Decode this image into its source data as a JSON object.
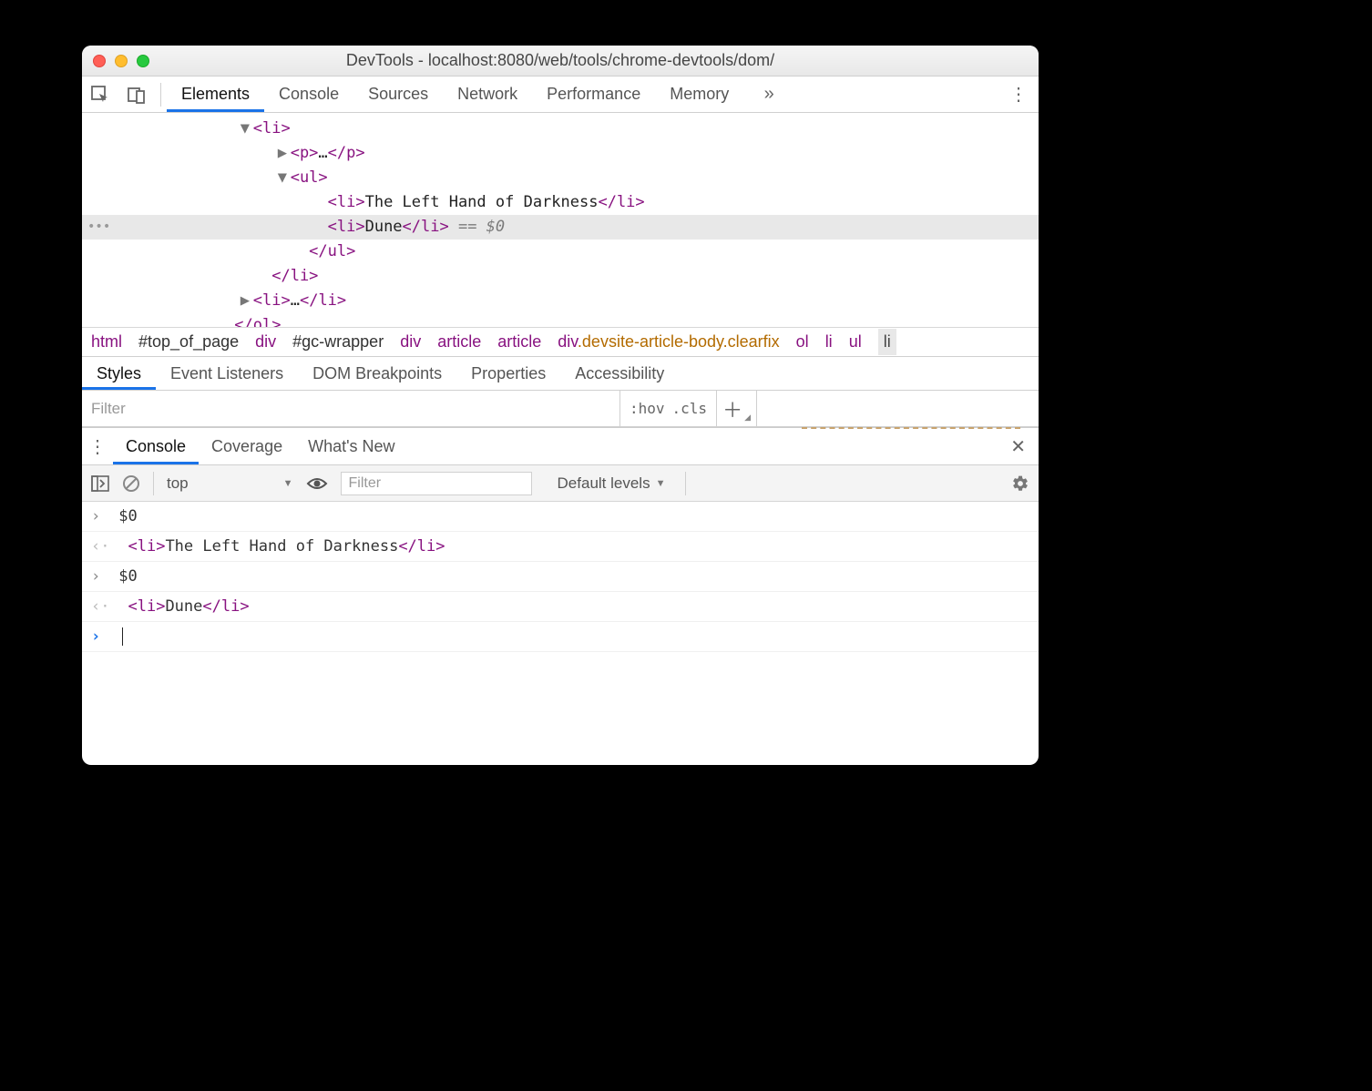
{
  "window": {
    "title": "DevTools - localhost:8080/web/tools/chrome-devtools/dom/"
  },
  "main_tabs": {
    "items": [
      "Elements",
      "Console",
      "Sources",
      "Network",
      "Performance",
      "Memory"
    ],
    "active_index": 0,
    "overflow_glyph": "»"
  },
  "dom_tree": {
    "lines": [
      {
        "indent": 11,
        "arrow": "▼",
        "open": "<li>",
        "text": "",
        "close": "",
        "selected": false
      },
      {
        "indent": 13,
        "arrow": "▶",
        "open": "<p>",
        "text": "…",
        "close": "</p>",
        "selected": false
      },
      {
        "indent": 13,
        "arrow": "▼",
        "open": "<ul>",
        "text": "",
        "close": "",
        "selected": false
      },
      {
        "indent": 15,
        "arrow": "",
        "open": "<li>",
        "text": "The Left Hand of Darkness",
        "close": "</li>",
        "selected": false
      },
      {
        "indent": 15,
        "arrow": "",
        "open": "<li>",
        "text": "Dune",
        "close": "</li>",
        "suffix": " == $0",
        "selected": true
      },
      {
        "indent": 14,
        "arrow": "",
        "open": "</ul>",
        "text": "",
        "close": "",
        "selected": false
      },
      {
        "indent": 12,
        "arrow": "",
        "open": "</li>",
        "text": "",
        "close": "",
        "selected": false
      },
      {
        "indent": 11,
        "arrow": "▶",
        "open": "<li>",
        "text": "…",
        "close": "</li>",
        "selected": false
      },
      {
        "indent": 10,
        "arrow": "",
        "open": "</ol>",
        "text": "",
        "close": "",
        "selected": false
      }
    ]
  },
  "breadcrumb": {
    "items": [
      {
        "label": "html",
        "kind": "tag"
      },
      {
        "label": "#top_of_page",
        "kind": "id"
      },
      {
        "label": "div",
        "kind": "tag"
      },
      {
        "label": "#gc-wrapper",
        "kind": "id"
      },
      {
        "label": "div",
        "kind": "tag"
      },
      {
        "label": "article",
        "kind": "tag"
      },
      {
        "label": "article",
        "kind": "tag"
      },
      {
        "label": "div.devsite-article-body.clearfix",
        "kind": "class"
      },
      {
        "label": "ol",
        "kind": "tag"
      },
      {
        "label": "li",
        "kind": "tag"
      },
      {
        "label": "ul",
        "kind": "tag"
      },
      {
        "label": "li",
        "kind": "selected"
      }
    ]
  },
  "styles_panel": {
    "tabs": [
      "Styles",
      "Event Listeners",
      "DOM Breakpoints",
      "Properties",
      "Accessibility"
    ],
    "active_index": 0,
    "filter_placeholder": "Filter",
    "hov_label": ":hov",
    "cls_label": ".cls",
    "plus_label": "＋"
  },
  "drawer": {
    "tabs": [
      "Console",
      "Coverage",
      "What's New"
    ],
    "active_index": 0
  },
  "console_toolbar": {
    "context": "top",
    "filter_placeholder": "Filter",
    "levels_label": "Default levels"
  },
  "console": {
    "entries": [
      {
        "kind": "input",
        "mark": "›",
        "content_plain": "$0"
      },
      {
        "kind": "output",
        "mark": "‹·",
        "pad": "  ",
        "open": "<li>",
        "text": "The Left Hand of Darkness",
        "close": "</li>"
      },
      {
        "kind": "input",
        "mark": "›",
        "content_plain": "$0"
      },
      {
        "kind": "output",
        "mark": "‹·",
        "pad": "  ",
        "open": "<li>",
        "text": "Dune",
        "close": "</li>"
      },
      {
        "kind": "prompt",
        "mark": "›"
      }
    ]
  }
}
